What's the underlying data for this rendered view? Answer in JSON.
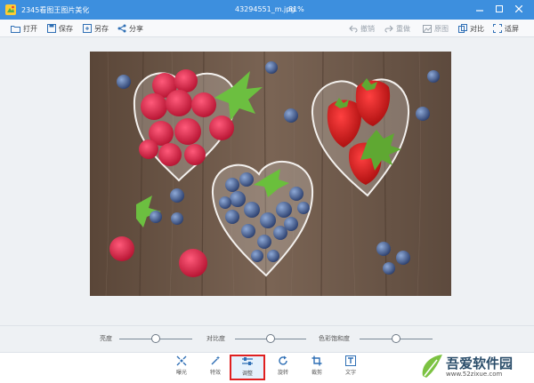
{
  "titlebar": {
    "app_title": "2345看图王图片美化",
    "file_name": "43294551_m.jpg",
    "zoom": "81%"
  },
  "toolbar": {
    "open": "打开",
    "save": "保存",
    "save_as": "另存",
    "share": "分享",
    "undo": "撤销",
    "redo": "重做",
    "original": "原图",
    "compare": "对比",
    "fit": "适屏"
  },
  "sliders": [
    {
      "label": "亮度",
      "value": 0.5
    },
    {
      "label": "对比度",
      "value": 0.5
    },
    {
      "label": "色彩饱和度",
      "value": 0.5
    }
  ],
  "tools": {
    "exposure": "曝光",
    "effects": "特效",
    "adjust": "调整",
    "rotate": "旋转",
    "crop": "裁剪",
    "text": "文字",
    "active": "adjust"
  },
  "watermark": {
    "main": "吾爱软件园",
    "url": "www.52zixue.com"
  },
  "colors": {
    "titlebar": "#3d8fde",
    "accent": "#e02020",
    "wood": "#6b5546"
  }
}
